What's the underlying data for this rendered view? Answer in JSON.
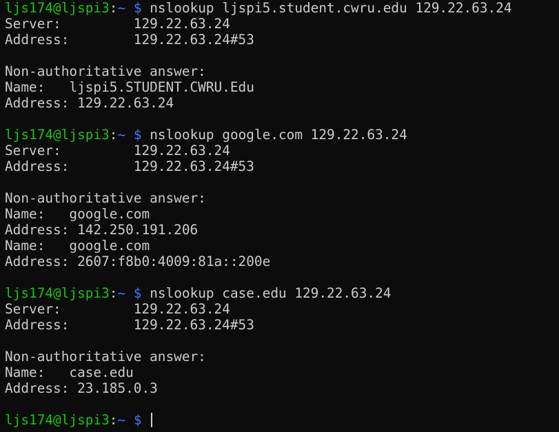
{
  "prompt": {
    "user_host": "ljs174@ljspi3",
    "sep": ":",
    "path": "~",
    "symbol": "$"
  },
  "blocks": [
    {
      "command": "nslookup ljspi5.student.cwru.edu 129.22.63.24",
      "output": [
        "Server:         129.22.63.24",
        "Address:        129.22.63.24#53",
        "",
        "Non-authoritative answer:",
        "Name:   ljspi5.STUDENT.CWRU.Edu",
        "Address: 129.22.63.24",
        ""
      ]
    },
    {
      "command": "nslookup google.com 129.22.63.24",
      "output": [
        "Server:         129.22.63.24",
        "Address:        129.22.63.24#53",
        "",
        "Non-authoritative answer:",
        "Name:   google.com",
        "Address: 142.250.191.206",
        "Name:   google.com",
        "Address: 2607:f8b0:4009:81a::200e",
        ""
      ]
    },
    {
      "command": "nslookup case.edu 129.22.63.24",
      "output": [
        "Server:         129.22.63.24",
        "Address:        129.22.63.24#53",
        "",
        "Non-authoritative answer:",
        "Name:   case.edu",
        "Address: 23.185.0.3",
        ""
      ]
    }
  ],
  "current_input": ""
}
